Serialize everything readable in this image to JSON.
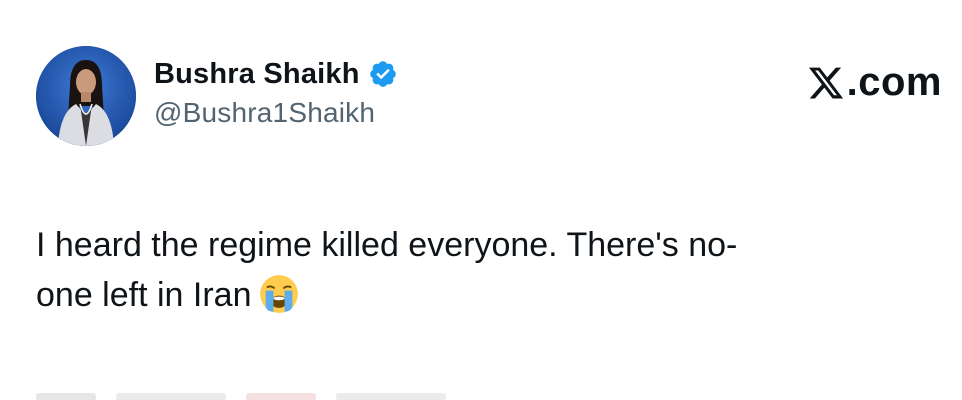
{
  "author": {
    "display_name": "Bushra Shaikh",
    "handle": "@Bushra1Shaikh",
    "verified": true,
    "avatar_icon": "profile-photo-avatar"
  },
  "source": {
    "label": ".com",
    "logo_icon": "x-logo-icon"
  },
  "tweet": {
    "text_line1": "I heard the regime killed everyone. There's no-",
    "text_line2": "one left in Iran",
    "emoji_icon": "loudly-crying-face-emoji"
  },
  "colors": {
    "verified_badge": "#1d9bf0",
    "handle_text": "#536471",
    "main_text": "#0f1419",
    "background": "#ffffff"
  }
}
